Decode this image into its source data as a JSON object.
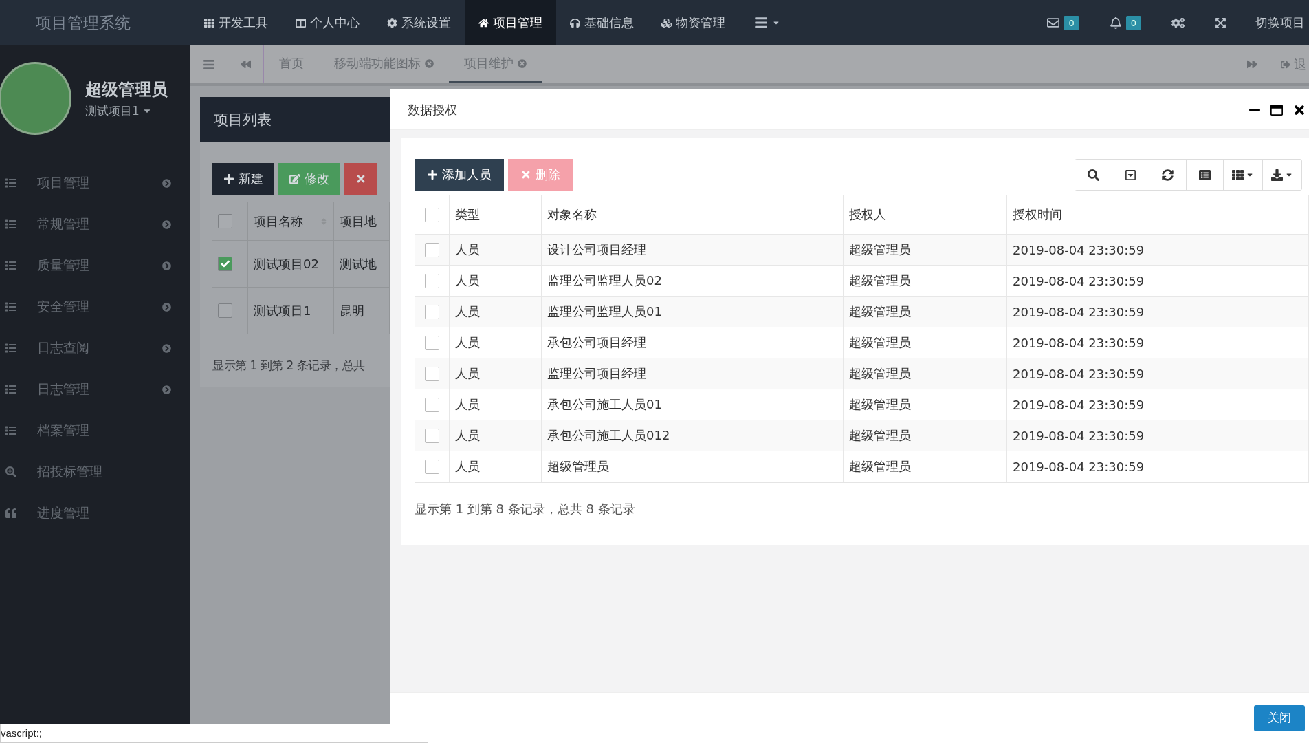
{
  "app_title": "项目管理系统",
  "top_menu": [
    {
      "label": "开发工具",
      "selected": false
    },
    {
      "label": "个人中心",
      "selected": false
    },
    {
      "label": "系统设置",
      "selected": false
    },
    {
      "label": "项目管理",
      "selected": true
    },
    {
      "label": "基础信息",
      "selected": false
    },
    {
      "label": "物资管理",
      "selected": false
    }
  ],
  "mail_count": "0",
  "bell_count": "0",
  "switch_label": "切换项目",
  "profile": {
    "name": "超级管理员",
    "project": "测试项目1"
  },
  "sidebar": [
    {
      "label": "项目管理",
      "kind": "list",
      "has_submenu": true
    },
    {
      "label": "常规管理",
      "kind": "list",
      "has_submenu": true
    },
    {
      "label": "质量管理",
      "kind": "list",
      "has_submenu": true
    },
    {
      "label": "安全管理",
      "kind": "list",
      "has_submenu": true
    },
    {
      "label": "日志查阅",
      "kind": "list",
      "has_submenu": true
    },
    {
      "label": "日志管理",
      "kind": "list",
      "has_submenu": true
    },
    {
      "label": "档案管理",
      "kind": "list",
      "has_submenu": false
    },
    {
      "label": "招投标管理",
      "kind": "search",
      "has_submenu": false
    },
    {
      "label": "进度管理",
      "kind": "quote",
      "has_submenu": false
    }
  ],
  "tabs": [
    {
      "label": "首页",
      "selected": false,
      "closable": false
    },
    {
      "label": "移动端功能图标",
      "selected": false,
      "closable": true
    },
    {
      "label": "项目维护",
      "selected": true,
      "closable": true
    }
  ],
  "logout_label": "退",
  "project_list": {
    "title": "项目列表",
    "buttons": [
      {
        "kind": "new",
        "label": "新建"
      },
      {
        "kind": "edit",
        "label": "修改"
      },
      {
        "kind": "delete"
      }
    ],
    "all_selected": false,
    "columns": [
      "项目名称",
      "项目地"
    ],
    "rows": [
      {
        "selected": true,
        "cells": [
          "测试项目02",
          "测试地"
        ]
      },
      {
        "selected": false,
        "cells": [
          "测试项目1",
          "昆明"
        ]
      }
    ],
    "footer": "显示第 1 到第 2 条记录，总共"
  },
  "dialog": {
    "title": "数据授权",
    "buttons": [
      {
        "kind": "add",
        "label": "添加人员",
        "disabled": false
      },
      {
        "kind": "delete",
        "label": "删除",
        "disabled": true
      }
    ],
    "all_selected": false,
    "columns": [
      "类型",
      "对象名称",
      "授权人",
      "授权时间"
    ],
    "rows": [
      {
        "selected": false,
        "cells": [
          "人员",
          "设计公司项目经理",
          "超级管理员",
          "2019-08-04 23:30:59"
        ]
      },
      {
        "selected": false,
        "cells": [
          "人员",
          "监理公司监理人员02",
          "超级管理员",
          "2019-08-04 23:30:59"
        ]
      },
      {
        "selected": false,
        "cells": [
          "人员",
          "监理公司监理人员01",
          "超级管理员",
          "2019-08-04 23:30:59"
        ]
      },
      {
        "selected": false,
        "cells": [
          "人员",
          "承包公司项目经理",
          "超级管理员",
          "2019-08-04 23:30:59"
        ]
      },
      {
        "selected": false,
        "cells": [
          "人员",
          "监理公司项目经理",
          "超级管理员",
          "2019-08-04 23:30:59"
        ]
      },
      {
        "selected": false,
        "cells": [
          "人员",
          "承包公司施工人员01",
          "超级管理员",
          "2019-08-04 23:30:59"
        ]
      },
      {
        "selected": false,
        "cells": [
          "人员",
          "承包公司施工人员012",
          "超级管理员",
          "2019-08-04 23:30:59"
        ]
      },
      {
        "selected": false,
        "cells": [
          "人员",
          "超级管理员",
          "超级管理员",
          "2019-08-04 23:30:59"
        ]
      }
    ],
    "footer": "显示第 1 到第 8 条记录，总共 8 条记录",
    "close_label": "关闭"
  },
  "status_bar": "vascript:;"
}
